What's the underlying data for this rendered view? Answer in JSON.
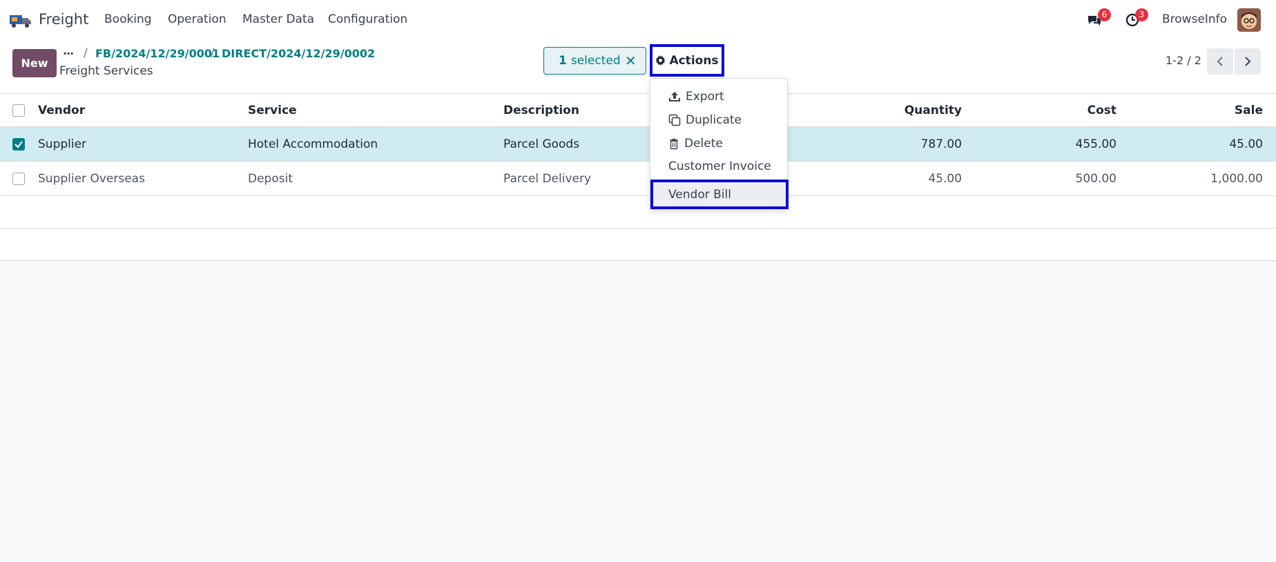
{
  "navbar": {
    "app_name": "Freight",
    "menus": [
      "Booking",
      "Operation",
      "Master Data",
      "Configuration"
    ],
    "messages_count": "6",
    "activities_count": "3",
    "user_name": "BrowseInfo"
  },
  "control_panel": {
    "new_label": "New",
    "breadcrumb_dots": "···",
    "breadcrumbs": [
      "FB/2024/12/29/0001",
      "DIRECT/2024/12/29/0002"
    ],
    "breadcrumb_sep": "/",
    "current": "Freight Services",
    "selected_count": "1",
    "selected_label": "selected",
    "clear_selection": "✕",
    "actions_label": "Actions",
    "pager_value": "1-2 / 2"
  },
  "actions_menu": {
    "items": [
      "Export",
      "Duplicate",
      "Delete",
      "Customer Invoice",
      "Vendor Bill"
    ]
  },
  "table": {
    "columns": [
      "Vendor",
      "Service",
      "Description",
      "Quantity",
      "Cost",
      "Sale"
    ],
    "rows": [
      {
        "vendor": "Supplier",
        "service": "Hotel Accommodation",
        "description": "Parcel Goods",
        "quantity": "787.00",
        "cost": "455.00",
        "sale": "45.00",
        "selected": true
      },
      {
        "vendor": "Supplier Overseas",
        "service": "Deposit",
        "description": "Parcel Delivery",
        "quantity": "45.00",
        "cost": "500.00",
        "sale": "1,000.00",
        "selected": false
      }
    ]
  },
  "colors": {
    "brand": "#714b67",
    "accent": "#017e84",
    "selected_row": "#d1ecf1",
    "highlight_border": "#0a0adb",
    "badge": "#e5303e"
  },
  "icons": {
    "app": "freight-truck-icon",
    "messages": "chat-bubbles-icon",
    "activities": "clock-icon",
    "actions": "gear-icon",
    "export": "upload-icon",
    "duplicate": "copy-icon",
    "delete": "trash-icon",
    "pager_prev": "chevron-left-icon",
    "pager_next": "chevron-right-icon"
  }
}
